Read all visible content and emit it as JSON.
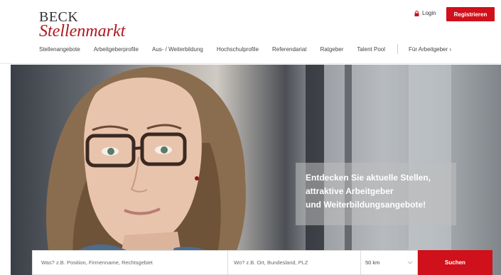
{
  "brand": {
    "line1": "BECK",
    "line2": "Stellenmarkt"
  },
  "header": {
    "login_label": "Login",
    "register_label": "Registrieren"
  },
  "nav": {
    "items": [
      {
        "label": "Stellenangebote"
      },
      {
        "label": "Arbeitgeberprofile"
      },
      {
        "label": "Aus- / Weiterbildung"
      },
      {
        "label": "Hochschulprofile"
      },
      {
        "label": "Referendariat"
      },
      {
        "label": "Ratgeber"
      },
      {
        "label": "Talent Pool"
      }
    ],
    "employer_label": "Für Arbeitgeber ›"
  },
  "hero": {
    "caption_lines": [
      "Entdecken Sie aktuelle Stellen,",
      "attraktive Arbeitgeber",
      "und Weiterbildungsangebote!"
    ]
  },
  "search": {
    "what_placeholder": "Was? z.B. Position, Firmenname, Rechtsgebiet",
    "where_placeholder": "Wo? z.B. Ort, Bundesland, PLZ",
    "radius_value": "50 km",
    "submit_label": "Suchen"
  },
  "colors": {
    "brand_red": "#d0101a",
    "logo_red": "#b0161b"
  }
}
